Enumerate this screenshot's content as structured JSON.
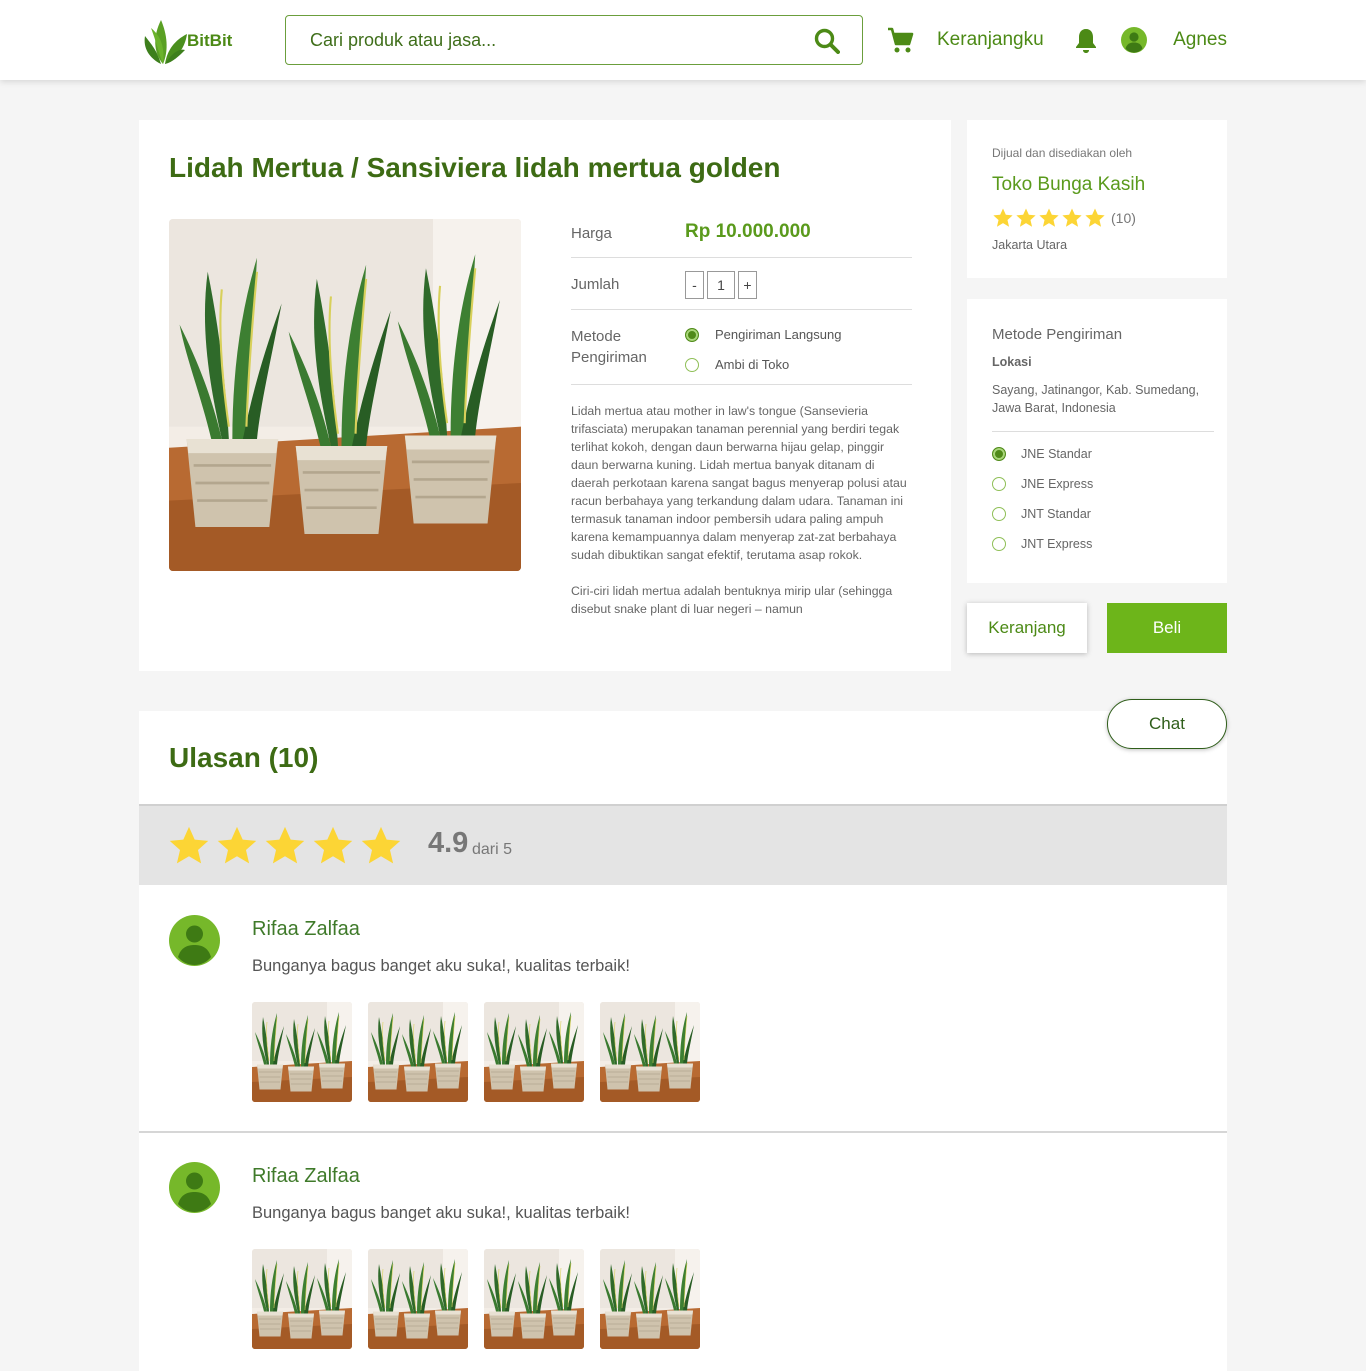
{
  "header": {
    "logo_text": "BitBit",
    "search_placeholder": "Cari produk atau jasa...",
    "cart_label": "Keranjangku",
    "user_name": "Agnes"
  },
  "product": {
    "title": "Lidah Mertua / Sansiviera lidah mertua golden",
    "price_label": "Harga",
    "price": "Rp 10.000.000",
    "qty_label": "Jumlah",
    "qty_minus": "-",
    "qty_value": "1",
    "qty_plus": "+",
    "method_label": "Metode Pengiriman",
    "methods": [
      {
        "label": "Pengiriman Langsung",
        "selected": true
      },
      {
        "label": "Ambi di Toko",
        "selected": false
      }
    ],
    "description": [
      "Lidah mertua atau mother in law's tongue (Sansevieria trifasciata) merupakan tanaman perennial yang berdiri tegak terlihat kokoh, dengan daun berwarna hijau gelap, pinggir daun berwarna kuning. Lidah mertua banyak ditanam di daerah perkotaan karena sangat bagus menyerap polusi atau racun berbahaya yang terkandung dalam udara. Tanaman ini termasuk tanaman indoor pembersih udara paling ampuh karena kemampuannya dalam menyerap zat-zat berbahaya sudah dibuktikan sangat efektif, terutama asap rokok.",
      "Ciri-ciri lidah mertua adalah bentuknya mirip ular (sehingga disebut snake plant di luar negeri – namun"
    ]
  },
  "seller": {
    "caption": "Dijual dan disediakan oleh",
    "name": "Toko Bunga Kasih",
    "rating_count": "(10)",
    "city": "Jakarta Utara"
  },
  "shipping": {
    "title": "Metode Pengiriman",
    "location_label": "Lokasi",
    "location": "Sayang, Jatinangor, Kab. Sumedang, Jawa Barat, Indonesia",
    "options": [
      {
        "label": "JNE Standar",
        "selected": true
      },
      {
        "label": "JNE Express",
        "selected": false
      },
      {
        "label": "JNT Standar",
        "selected": false
      },
      {
        "label": "JNT Express",
        "selected": false
      }
    ]
  },
  "actions": {
    "cart": "Keranjang",
    "buy": "Beli",
    "chat": "Chat"
  },
  "reviews": {
    "title": "Ulasan (10)",
    "score": "4.9",
    "score_of": "dari 5",
    "items": [
      {
        "name": "Rifaa Zalfaa",
        "text": "Bunganya bagus banget aku suka!, kualitas terbaik!"
      },
      {
        "name": "Rifaa Zalfaa",
        "text": "Bunganya bagus banget aku suka!, kualitas terbaik!"
      }
    ]
  },
  "colors": {
    "brand": "#4c8a16",
    "buy_button": "#6db51a",
    "star": "#fcd535"
  }
}
